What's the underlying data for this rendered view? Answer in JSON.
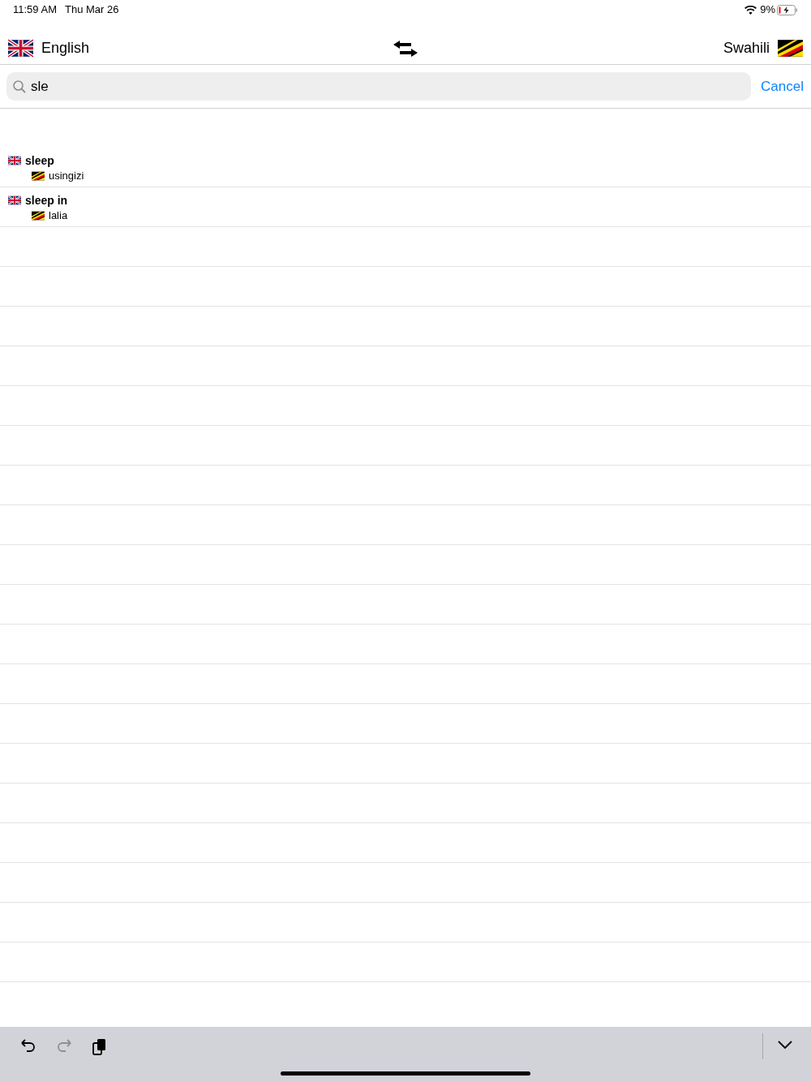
{
  "status_bar": {
    "time": "11:59 AM",
    "date": "Thu Mar 26",
    "battery": "9%"
  },
  "header": {
    "source_language": "English",
    "target_language": "Swahili"
  },
  "search": {
    "value": "sle",
    "cancel": "Cancel"
  },
  "results": [
    {
      "term": "sleep",
      "translation": "usingizi"
    },
    {
      "term": "sleep in",
      "translation": "lalia"
    }
  ],
  "keyboard_toolbar": [
    {
      "kind": "undo",
      "disabled": false
    },
    {
      "kind": "redo",
      "disabled": true
    },
    {
      "kind": "paste",
      "disabled": false
    }
  ]
}
